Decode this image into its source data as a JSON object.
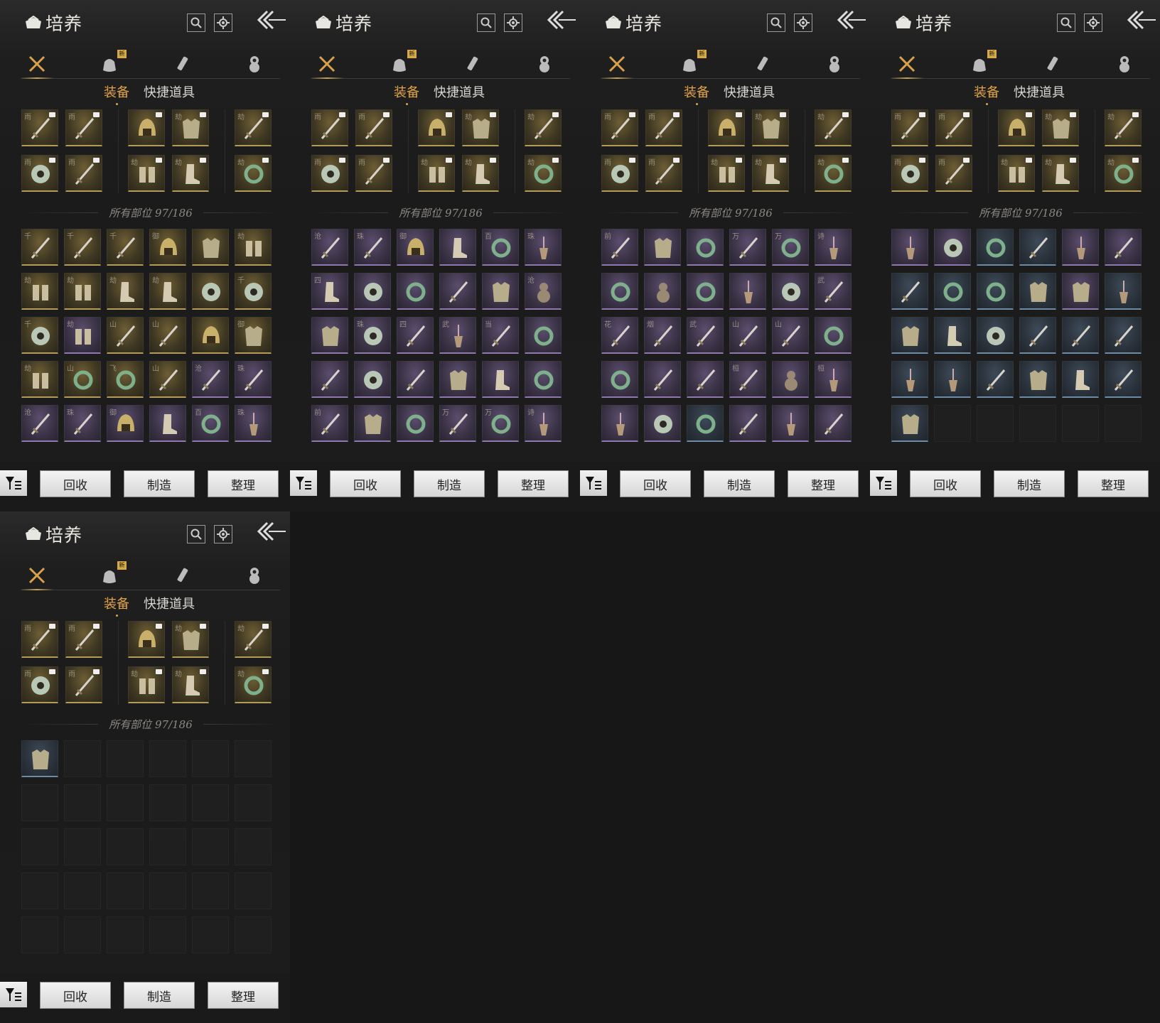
{
  "header": {
    "title": "培养"
  },
  "subtabs": {
    "equipment": "装备",
    "quick_items": "快捷道具"
  },
  "new_badge": "新",
  "count_text": "所有部位 97/186",
  "buttons": {
    "recycle": "回收",
    "craft": "制造",
    "sort": "整理"
  },
  "equipped": {
    "chars": [
      "雨",
      "雨",
      "",
      "劫",
      "劫",
      "雨",
      "雨",
      "劫",
      "劫",
      "劫"
    ]
  },
  "panels": [
    {
      "page": 1,
      "items": [
        {
          "ch": "千",
          "r": "gold",
          "i": "sword"
        },
        {
          "ch": "千",
          "r": "gold",
          "i": "sword"
        },
        {
          "ch": "千",
          "r": "gold",
          "i": "sword"
        },
        {
          "ch": "御",
          "r": "gold",
          "i": "helm"
        },
        {
          "ch": "",
          "r": "gold",
          "i": "armor"
        },
        {
          "ch": "劫",
          "r": "gold",
          "i": "bracer"
        },
        {
          "ch": "劫",
          "r": "gold",
          "i": "bracer"
        },
        {
          "ch": "劫",
          "r": "gold",
          "i": "bracer"
        },
        {
          "ch": "劫",
          "r": "gold",
          "i": "boot"
        },
        {
          "ch": "劫",
          "r": "gold",
          "i": "boot"
        },
        {
          "ch": "",
          "r": "gold",
          "i": "disc"
        },
        {
          "ch": "千",
          "r": "gold",
          "i": "disc"
        },
        {
          "ch": "千",
          "r": "gold",
          "i": "disc"
        },
        {
          "ch": "劫",
          "r": "purple",
          "i": "bracer"
        },
        {
          "ch": "山",
          "r": "gold",
          "i": "sword"
        },
        {
          "ch": "山",
          "r": "gold",
          "i": "sword"
        },
        {
          "ch": "",
          "r": "gold",
          "i": "helm"
        },
        {
          "ch": "御",
          "r": "gold",
          "i": "armor"
        },
        {
          "ch": "劫",
          "r": "gold",
          "i": "bracer"
        },
        {
          "ch": "山",
          "r": "gold",
          "i": "ring"
        },
        {
          "ch": "飞",
          "r": "gold",
          "i": "ring"
        },
        {
          "ch": "山",
          "r": "gold",
          "i": "sword"
        },
        {
          "ch": "沧",
          "r": "purple",
          "i": "sword"
        },
        {
          "ch": "珠",
          "r": "purple",
          "i": "sword"
        },
        {
          "ch": "沧",
          "r": "purple",
          "i": "sword"
        },
        {
          "ch": "珠",
          "r": "purple",
          "i": "sword"
        },
        {
          "ch": "御",
          "r": "purple",
          "i": "helm"
        },
        {
          "ch": "",
          "r": "purple",
          "i": "boot"
        },
        {
          "ch": "百",
          "r": "purple",
          "i": "ring"
        },
        {
          "ch": "珠",
          "r": "purple",
          "i": "tassel"
        }
      ]
    },
    {
      "page": 2,
      "items": [
        {
          "ch": "沧",
          "r": "purple",
          "i": "sword"
        },
        {
          "ch": "珠",
          "r": "purple",
          "i": "sword"
        },
        {
          "ch": "御",
          "r": "purple",
          "i": "helm"
        },
        {
          "ch": "",
          "r": "purple",
          "i": "boot"
        },
        {
          "ch": "百",
          "r": "purple",
          "i": "ring"
        },
        {
          "ch": "珠",
          "r": "purple",
          "i": "tassel"
        },
        {
          "ch": "四",
          "r": "purple",
          "i": "boot"
        },
        {
          "ch": "",
          "r": "purple",
          "i": "disc"
        },
        {
          "ch": "",
          "r": "purple",
          "i": "ring"
        },
        {
          "ch": "",
          "r": "purple",
          "i": "sword"
        },
        {
          "ch": "",
          "r": "purple",
          "i": "armor"
        },
        {
          "ch": "沧",
          "r": "purple",
          "i": "gourd"
        },
        {
          "ch": "",
          "r": "purple",
          "i": "armor"
        },
        {
          "ch": "珠",
          "r": "purple",
          "i": "disc"
        },
        {
          "ch": "四",
          "r": "purple",
          "i": "sword"
        },
        {
          "ch": "武",
          "r": "purple",
          "i": "tassel"
        },
        {
          "ch": "当",
          "r": "purple",
          "i": "sword"
        },
        {
          "ch": "",
          "r": "purple",
          "i": "ring"
        },
        {
          "ch": "",
          "r": "purple",
          "i": "sword"
        },
        {
          "ch": "",
          "r": "purple",
          "i": "disc"
        },
        {
          "ch": "",
          "r": "purple",
          "i": "sword"
        },
        {
          "ch": "",
          "r": "purple",
          "i": "armor"
        },
        {
          "ch": "",
          "r": "purple",
          "i": "boot"
        },
        {
          "ch": "",
          "r": "purple",
          "i": "ring"
        },
        {
          "ch": "前",
          "r": "purple",
          "i": "sword"
        },
        {
          "ch": "",
          "r": "purple",
          "i": "armor"
        },
        {
          "ch": "",
          "r": "purple",
          "i": "ring"
        },
        {
          "ch": "万",
          "r": "purple",
          "i": "sword"
        },
        {
          "ch": "万",
          "r": "purple",
          "i": "ring"
        },
        {
          "ch": "诗",
          "r": "purple",
          "i": "tassel"
        }
      ]
    },
    {
      "page": 3,
      "items": [
        {
          "ch": "前",
          "r": "purple",
          "i": "sword"
        },
        {
          "ch": "",
          "r": "purple",
          "i": "armor"
        },
        {
          "ch": "",
          "r": "purple",
          "i": "ring"
        },
        {
          "ch": "万",
          "r": "purple",
          "i": "sword"
        },
        {
          "ch": "万",
          "r": "purple",
          "i": "ring"
        },
        {
          "ch": "诗",
          "r": "purple",
          "i": "tassel"
        },
        {
          "ch": "",
          "r": "purple",
          "i": "ring"
        },
        {
          "ch": "",
          "r": "purple",
          "i": "gourd"
        },
        {
          "ch": "",
          "r": "purple",
          "i": "ring"
        },
        {
          "ch": "",
          "r": "purple",
          "i": "tassel"
        },
        {
          "ch": "",
          "r": "purple",
          "i": "disc"
        },
        {
          "ch": "武",
          "r": "purple",
          "i": "sword"
        },
        {
          "ch": "花",
          "r": "purple",
          "i": "sword"
        },
        {
          "ch": "烟",
          "r": "purple",
          "i": "sword"
        },
        {
          "ch": "武",
          "r": "purple",
          "i": "sword"
        },
        {
          "ch": "山",
          "r": "purple",
          "i": "sword"
        },
        {
          "ch": "山",
          "r": "purple",
          "i": "sword"
        },
        {
          "ch": "",
          "r": "purple",
          "i": "ring"
        },
        {
          "ch": "",
          "r": "purple",
          "i": "ring"
        },
        {
          "ch": "",
          "r": "purple",
          "i": "sword"
        },
        {
          "ch": "",
          "r": "purple",
          "i": "sword"
        },
        {
          "ch": "桓",
          "r": "purple",
          "i": "sword"
        },
        {
          "ch": "",
          "r": "purple",
          "i": "gourd"
        },
        {
          "ch": "桓",
          "r": "purple",
          "i": "tassel"
        },
        {
          "ch": "",
          "r": "purple",
          "i": "tassel"
        },
        {
          "ch": "",
          "r": "purple",
          "i": "disc"
        },
        {
          "ch": "",
          "r": "blue",
          "i": "ring"
        },
        {
          "ch": "",
          "r": "purple",
          "i": "sword"
        },
        {
          "ch": "",
          "r": "purple",
          "i": "tassel"
        },
        {
          "ch": "",
          "r": "purple",
          "i": "sword"
        }
      ]
    },
    {
      "page": 4,
      "items": [
        {
          "ch": "",
          "r": "purple",
          "i": "tassel"
        },
        {
          "ch": "",
          "r": "purple",
          "i": "disc"
        },
        {
          "ch": "",
          "r": "blue",
          "i": "ring"
        },
        {
          "ch": "",
          "r": "blue",
          "i": "sword"
        },
        {
          "ch": "",
          "r": "purple",
          "i": "tassel"
        },
        {
          "ch": "",
          "r": "purple",
          "i": "sword"
        },
        {
          "ch": "",
          "r": "blue",
          "i": "sword"
        },
        {
          "ch": "",
          "r": "blue",
          "i": "ring"
        },
        {
          "ch": "",
          "r": "blue",
          "i": "ring"
        },
        {
          "ch": "",
          "r": "blue",
          "i": "armor"
        },
        {
          "ch": "",
          "r": "purple",
          "i": "armor"
        },
        {
          "ch": "",
          "r": "blue",
          "i": "tassel"
        },
        {
          "ch": "",
          "r": "blue",
          "i": "armor"
        },
        {
          "ch": "",
          "r": "blue",
          "i": "boot"
        },
        {
          "ch": "",
          "r": "blue",
          "i": "disc"
        },
        {
          "ch": "",
          "r": "blue",
          "i": "sword"
        },
        {
          "ch": "",
          "r": "blue",
          "i": "sword"
        },
        {
          "ch": "",
          "r": "blue",
          "i": "sword"
        },
        {
          "ch": "",
          "r": "blue",
          "i": "tassel"
        },
        {
          "ch": "",
          "r": "blue",
          "i": "tassel"
        },
        {
          "ch": "",
          "r": "blue",
          "i": "sword"
        },
        {
          "ch": "",
          "r": "blue",
          "i": "armor"
        },
        {
          "ch": "",
          "r": "blue",
          "i": "boot"
        },
        {
          "ch": "",
          "r": "blue",
          "i": "sword"
        },
        {
          "ch": "",
          "r": "blue",
          "i": "armor"
        },
        {
          "ch": "",
          "r": "empty",
          "i": ""
        },
        {
          "ch": "",
          "r": "empty",
          "i": ""
        },
        {
          "ch": "",
          "r": "empty",
          "i": ""
        },
        {
          "ch": "",
          "r": "empty",
          "i": ""
        },
        {
          "ch": "",
          "r": "empty",
          "i": ""
        }
      ]
    },
    {
      "page": 5,
      "items": [
        {
          "ch": "",
          "r": "blue",
          "i": "armor"
        },
        {
          "ch": "",
          "r": "empty",
          "i": ""
        },
        {
          "ch": "",
          "r": "empty",
          "i": ""
        },
        {
          "ch": "",
          "r": "empty",
          "i": ""
        },
        {
          "ch": "",
          "r": "empty",
          "i": ""
        },
        {
          "ch": "",
          "r": "empty",
          "i": ""
        },
        {
          "ch": "",
          "r": "empty",
          "i": ""
        },
        {
          "ch": "",
          "r": "empty",
          "i": ""
        },
        {
          "ch": "",
          "r": "empty",
          "i": ""
        },
        {
          "ch": "",
          "r": "empty",
          "i": ""
        },
        {
          "ch": "",
          "r": "empty",
          "i": ""
        },
        {
          "ch": "",
          "r": "empty",
          "i": ""
        },
        {
          "ch": "",
          "r": "empty",
          "i": ""
        },
        {
          "ch": "",
          "r": "empty",
          "i": ""
        },
        {
          "ch": "",
          "r": "empty",
          "i": ""
        },
        {
          "ch": "",
          "r": "empty",
          "i": ""
        },
        {
          "ch": "",
          "r": "empty",
          "i": ""
        },
        {
          "ch": "",
          "r": "empty",
          "i": ""
        },
        {
          "ch": "",
          "r": "empty",
          "i": ""
        },
        {
          "ch": "",
          "r": "empty",
          "i": ""
        },
        {
          "ch": "",
          "r": "empty",
          "i": ""
        },
        {
          "ch": "",
          "r": "empty",
          "i": ""
        },
        {
          "ch": "",
          "r": "empty",
          "i": ""
        },
        {
          "ch": "",
          "r": "empty",
          "i": ""
        },
        {
          "ch": "",
          "r": "empty",
          "i": ""
        },
        {
          "ch": "",
          "r": "empty",
          "i": ""
        },
        {
          "ch": "",
          "r": "empty",
          "i": ""
        },
        {
          "ch": "",
          "r": "empty",
          "i": ""
        },
        {
          "ch": "",
          "r": "empty",
          "i": ""
        },
        {
          "ch": "",
          "r": "empty",
          "i": ""
        }
      ]
    }
  ],
  "colors": {
    "accent": "#e0a349",
    "gold_rarity": "#b69a5a",
    "purple_rarity": "#8e78ad",
    "blue_rarity": "#6d8aa6"
  }
}
